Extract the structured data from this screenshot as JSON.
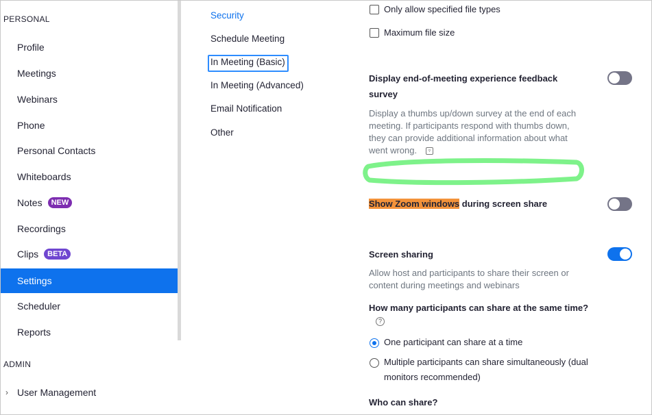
{
  "sidebar": {
    "personal_heading": "PERSONAL",
    "admin_heading": "ADMIN",
    "items": [
      {
        "label": "Profile"
      },
      {
        "label": "Meetings"
      },
      {
        "label": "Webinars"
      },
      {
        "label": "Phone"
      },
      {
        "label": "Personal Contacts"
      },
      {
        "label": "Whiteboards"
      },
      {
        "label": "Notes",
        "badge": "NEW"
      },
      {
        "label": "Recordings"
      },
      {
        "label": "Clips",
        "badge": "BETA"
      },
      {
        "label": "Settings",
        "active": true
      },
      {
        "label": "Scheduler"
      },
      {
        "label": "Reports"
      }
    ],
    "admin_items": [
      {
        "label": "User Management",
        "icon": "chevron-right-icon"
      }
    ]
  },
  "subnav": {
    "items": [
      {
        "label": "Security"
      },
      {
        "label": "Schedule Meeting"
      },
      {
        "label": "In Meeting (Basic)",
        "selected": true
      },
      {
        "label": "In Meeting (Advanced)"
      },
      {
        "label": "Email Notification"
      },
      {
        "label": "Other"
      }
    ]
  },
  "content": {
    "file_types_label": "Only allow specified file types",
    "max_file_size_label": "Maximum file size",
    "feedback": {
      "title_line1": "Display end-of-meeting experience feedback",
      "title_line2": "survey",
      "desc_lines": [
        "Display a thumbs up/down survey at the end of each",
        "meeting. If participants respond with thumbs down,",
        "they can provide additional information about what",
        "went wrong."
      ],
      "enabled": false
    },
    "show_zoom_windows": {
      "highlight": "Show Zoom windows",
      "rest": " during screen share",
      "enabled": false
    },
    "screen_sharing": {
      "title": "Screen sharing",
      "desc_lines": [
        "Allow host and participants to share their screen or",
        "content during meetings and webinars"
      ],
      "enabled": true,
      "question": "How many participants can share at the same time?",
      "options": [
        {
          "line1": "One participant can share at a time",
          "checked": true
        },
        {
          "line1": "Multiple participants can share simultaneously (dual",
          "line2": "monitors recommended)",
          "checked": false
        }
      ],
      "who_can_share": "Who can share?"
    }
  },
  "colors": {
    "accent": "#0e72ed",
    "highlight": "#f3923a",
    "annotation": "#7ef28a"
  }
}
